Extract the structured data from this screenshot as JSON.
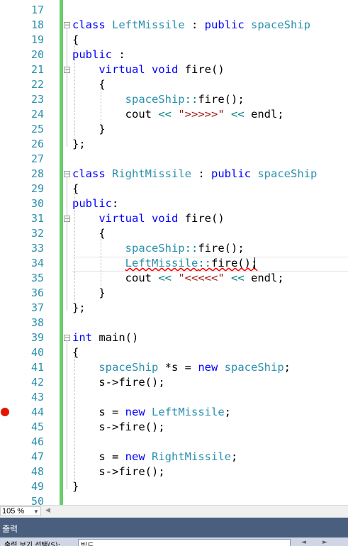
{
  "editor": {
    "lines": [
      {
        "n": "17",
        "tokens": []
      },
      {
        "n": "18",
        "tokens": [
          {
            "c": "kw",
            "t": "class"
          },
          {
            "c": "",
            "t": " "
          },
          {
            "c": "ty",
            "t": "LeftMissile"
          },
          {
            "c": "",
            "t": " : "
          },
          {
            "c": "kw",
            "t": "public"
          },
          {
            "c": "",
            "t": " "
          },
          {
            "c": "ty",
            "t": "spaceShip"
          }
        ]
      },
      {
        "n": "19",
        "tokens": [
          {
            "c": "",
            "t": "{"
          }
        ]
      },
      {
        "n": "20",
        "tokens": [
          {
            "c": "kw",
            "t": "public"
          },
          {
            "c": "",
            "t": " :"
          }
        ]
      },
      {
        "n": "21",
        "tokens": [
          {
            "c": "",
            "t": "    "
          },
          {
            "c": "kw",
            "t": "virtual"
          },
          {
            "c": "",
            "t": " "
          },
          {
            "c": "kw",
            "t": "void"
          },
          {
            "c": "",
            "t": " fire()"
          }
        ]
      },
      {
        "n": "22",
        "tokens": [
          {
            "c": "",
            "t": "    {"
          }
        ]
      },
      {
        "n": "23",
        "tokens": [
          {
            "c": "",
            "t": "        "
          },
          {
            "c": "ty",
            "t": "spaceShip"
          },
          {
            "c": "op",
            "t": "::"
          },
          {
            "c": "",
            "t": "fire();"
          }
        ]
      },
      {
        "n": "24",
        "tokens": [
          {
            "c": "",
            "t": "        cout "
          },
          {
            "c": "op",
            "t": "<<"
          },
          {
            "c": "",
            "t": " "
          },
          {
            "c": "str",
            "t": "\">>>>>\""
          },
          {
            "c": "",
            "t": " "
          },
          {
            "c": "op",
            "t": "<<"
          },
          {
            "c": "",
            "t": " endl;"
          }
        ]
      },
      {
        "n": "25",
        "tokens": [
          {
            "c": "",
            "t": "    }"
          }
        ]
      },
      {
        "n": "26",
        "tokens": [
          {
            "c": "",
            "t": "};"
          }
        ]
      },
      {
        "n": "27",
        "tokens": []
      },
      {
        "n": "28",
        "tokens": [
          {
            "c": "kw",
            "t": "class"
          },
          {
            "c": "",
            "t": " "
          },
          {
            "c": "ty",
            "t": "RightMissile"
          },
          {
            "c": "",
            "t": " : "
          },
          {
            "c": "kw",
            "t": "public"
          },
          {
            "c": "",
            "t": " "
          },
          {
            "c": "ty",
            "t": "spaceShip"
          }
        ]
      },
      {
        "n": "29",
        "tokens": [
          {
            "c": "",
            "t": "{"
          }
        ]
      },
      {
        "n": "30",
        "tokens": [
          {
            "c": "kw",
            "t": "public"
          },
          {
            "c": "",
            "t": ":"
          }
        ]
      },
      {
        "n": "31",
        "tokens": [
          {
            "c": "",
            "t": "    "
          },
          {
            "c": "kw",
            "t": "virtual"
          },
          {
            "c": "",
            "t": " "
          },
          {
            "c": "kw",
            "t": "void"
          },
          {
            "c": "",
            "t": " fire()"
          }
        ]
      },
      {
        "n": "32",
        "tokens": [
          {
            "c": "",
            "t": "    {"
          }
        ]
      },
      {
        "n": "33",
        "tokens": [
          {
            "c": "",
            "t": "        "
          },
          {
            "c": "ty",
            "t": "spaceShip"
          },
          {
            "c": "op",
            "t": "::"
          },
          {
            "c": "",
            "t": "fire();"
          }
        ]
      },
      {
        "n": "34",
        "tokens": [
          {
            "c": "",
            "t": "        "
          },
          {
            "c": "ty squig",
            "t": "LeftMissile"
          },
          {
            "c": "op squig",
            "t": "::"
          },
          {
            "c": "squig",
            "t": "fire();"
          }
        ]
      },
      {
        "n": "35",
        "tokens": [
          {
            "c": "",
            "t": "        cout "
          },
          {
            "c": "op",
            "t": "<<"
          },
          {
            "c": "",
            "t": " "
          },
          {
            "c": "str",
            "t": "\"<<<<<\""
          },
          {
            "c": "",
            "t": " "
          },
          {
            "c": "op",
            "t": "<<"
          },
          {
            "c": "",
            "t": " endl;"
          }
        ]
      },
      {
        "n": "36",
        "tokens": [
          {
            "c": "",
            "t": "    }"
          }
        ]
      },
      {
        "n": "37",
        "tokens": [
          {
            "c": "",
            "t": "};"
          }
        ]
      },
      {
        "n": "38",
        "tokens": []
      },
      {
        "n": "39",
        "tokens": [
          {
            "c": "kw",
            "t": "int"
          },
          {
            "c": "",
            "t": " main()"
          }
        ]
      },
      {
        "n": "40",
        "tokens": [
          {
            "c": "",
            "t": "{"
          }
        ]
      },
      {
        "n": "41",
        "tokens": [
          {
            "c": "",
            "t": "    "
          },
          {
            "c": "ty",
            "t": "spaceShip"
          },
          {
            "c": "",
            "t": " *s = "
          },
          {
            "c": "kw",
            "t": "new"
          },
          {
            "c": "",
            "t": " "
          },
          {
            "c": "ty",
            "t": "spaceShip"
          },
          {
            "c": "",
            "t": ";"
          }
        ]
      },
      {
        "n": "42",
        "tokens": [
          {
            "c": "",
            "t": "    s->fire();"
          }
        ]
      },
      {
        "n": "43",
        "tokens": []
      },
      {
        "n": "44",
        "tokens": [
          {
            "c": "",
            "t": "    s = "
          },
          {
            "c": "kw",
            "t": "new"
          },
          {
            "c": "",
            "t": " "
          },
          {
            "c": "ty",
            "t": "LeftMissile"
          },
          {
            "c": "",
            "t": ";"
          }
        ]
      },
      {
        "n": "45",
        "tokens": [
          {
            "c": "",
            "t": "    s->fire();"
          }
        ]
      },
      {
        "n": "46",
        "tokens": []
      },
      {
        "n": "47",
        "tokens": [
          {
            "c": "",
            "t": "    s = "
          },
          {
            "c": "kw",
            "t": "new"
          },
          {
            "c": "",
            "t": " "
          },
          {
            "c": "ty",
            "t": "RightMissile"
          },
          {
            "c": "",
            "t": ";"
          }
        ]
      },
      {
        "n": "48",
        "tokens": [
          {
            "c": "",
            "t": "    s->fire();"
          }
        ]
      },
      {
        "n": "49",
        "tokens": [
          {
            "c": "",
            "t": "}"
          }
        ]
      },
      {
        "n": "50",
        "tokens": []
      }
    ],
    "breakpoint_line": "44",
    "current_line": "34",
    "fold_markers": [
      "18",
      "21",
      "28",
      "31",
      "39"
    ]
  },
  "status": {
    "zoom": "105 %"
  },
  "output": {
    "title": "출력",
    "show_label": "출력 보기 선택(S):",
    "source": "빌드"
  },
  "colors": {
    "keyword": "#0000ff",
    "type": "#2b91af",
    "string": "#a31515",
    "change_bar": "#6ccc6c",
    "breakpoint": "#e51400",
    "output_header": "#4a5e7d"
  }
}
